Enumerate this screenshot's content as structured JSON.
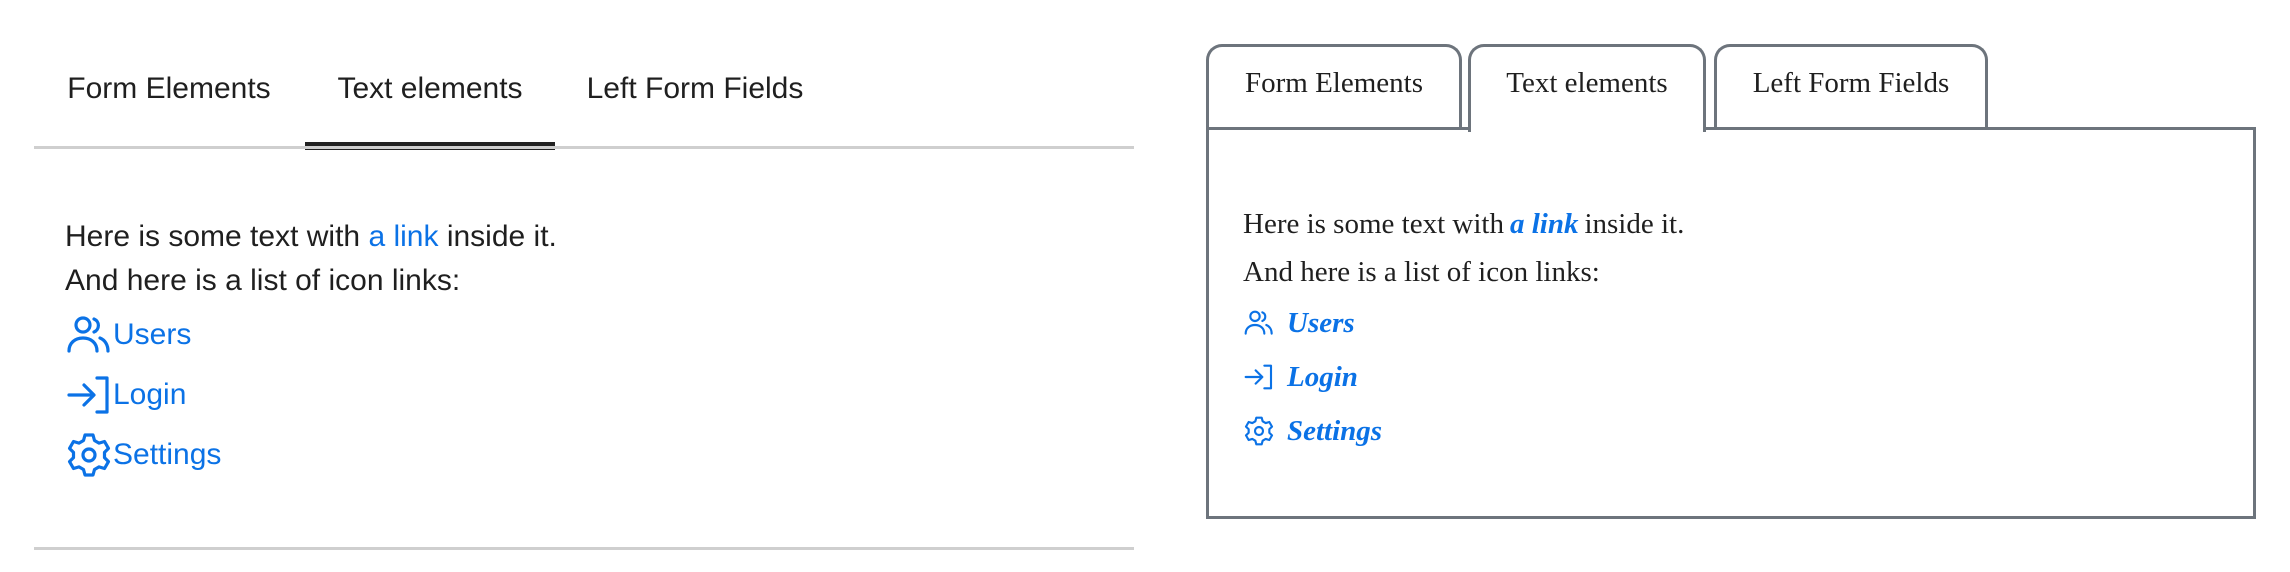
{
  "left": {
    "tabs": [
      {
        "label": "Form Elements"
      },
      {
        "label": "Text elements"
      },
      {
        "label": "Left Form Fields"
      }
    ],
    "active_tab": "Text elements",
    "text_before": "Here is some text with ",
    "link_text": "a link",
    "text_after": " inside it.",
    "list_intro": "And here is a list of icon links:",
    "icon_links": [
      {
        "icon": "users-icon",
        "label": "Users"
      },
      {
        "icon": "login-icon",
        "label": "Login"
      },
      {
        "icon": "settings-icon",
        "label": "Settings"
      }
    ]
  },
  "right": {
    "tabs": [
      {
        "label": "Form Elements"
      },
      {
        "label": "Text elements"
      },
      {
        "label": "Left Form Fields"
      }
    ],
    "active_tab": "Text elements",
    "text_before": "Here is some text with",
    "link_text": "a link",
    "text_after": "inside it.",
    "list_intro": "And here is a list of icon links:",
    "icon_links": [
      {
        "icon": "users-icon",
        "label": "Users"
      },
      {
        "icon": "login-icon",
        "label": "Login"
      },
      {
        "icon": "settings-icon",
        "label": "Settings"
      }
    ]
  },
  "colors": {
    "link": "#0b72e6",
    "active_tab_underline": "#222222",
    "border": "#6d747c",
    "divider": "#cfcfcf"
  }
}
